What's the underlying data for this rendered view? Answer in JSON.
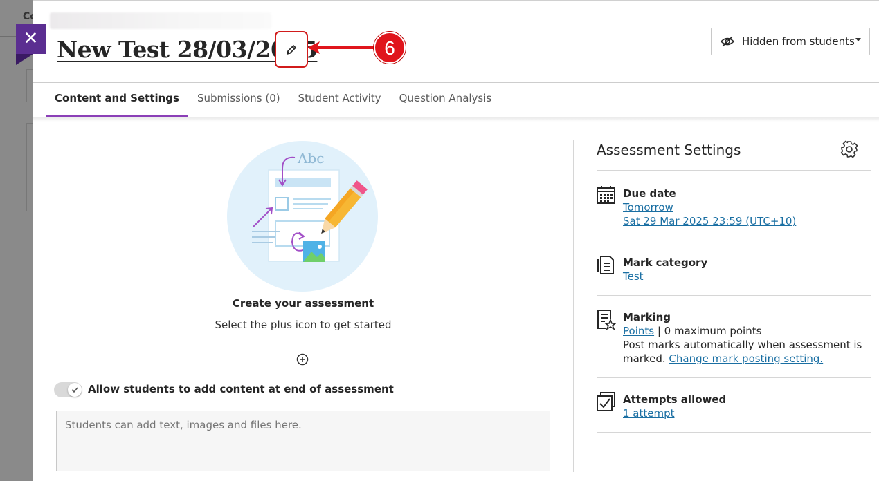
{
  "background": {
    "partial_text": "Co"
  },
  "header": {
    "title": "New Test 28/03/2025",
    "visibility": "Hidden from students",
    "callout_number": "6"
  },
  "tabs": [
    {
      "label": "Content and Settings",
      "active": true
    },
    {
      "label": "Submissions (0)",
      "active": false
    },
    {
      "label": "Student Activity",
      "active": false
    },
    {
      "label": "Question Analysis",
      "active": false
    }
  ],
  "content": {
    "illustration_text": "Abc",
    "heading": "Create your assessment",
    "subheading": "Select the plus icon to get started",
    "allow_label": "Allow students to add content at end of assessment",
    "student_box_placeholder": "Students can add text, images and files here."
  },
  "settings": {
    "title": "Assessment Settings",
    "due_date": {
      "label": "Due date",
      "relative": "Tomorrow",
      "absolute": "Sat 29 Mar 2025 23:59 (UTC+10)"
    },
    "mark_category": {
      "label": "Mark category",
      "value": "Test"
    },
    "marking": {
      "label": "Marking",
      "link": "Points",
      "points_text": "| 0 maximum points",
      "post_text": "Post marks automatically when assessment is marked.",
      "change_link": "Change mark posting setting."
    },
    "attempts": {
      "label": "Attempts allowed",
      "value": "1 attempt"
    }
  },
  "colors": {
    "accent": "#8b3fb7",
    "close": "#5b2e91",
    "callout": "#e0151c",
    "link": "#1a6fa3"
  }
}
